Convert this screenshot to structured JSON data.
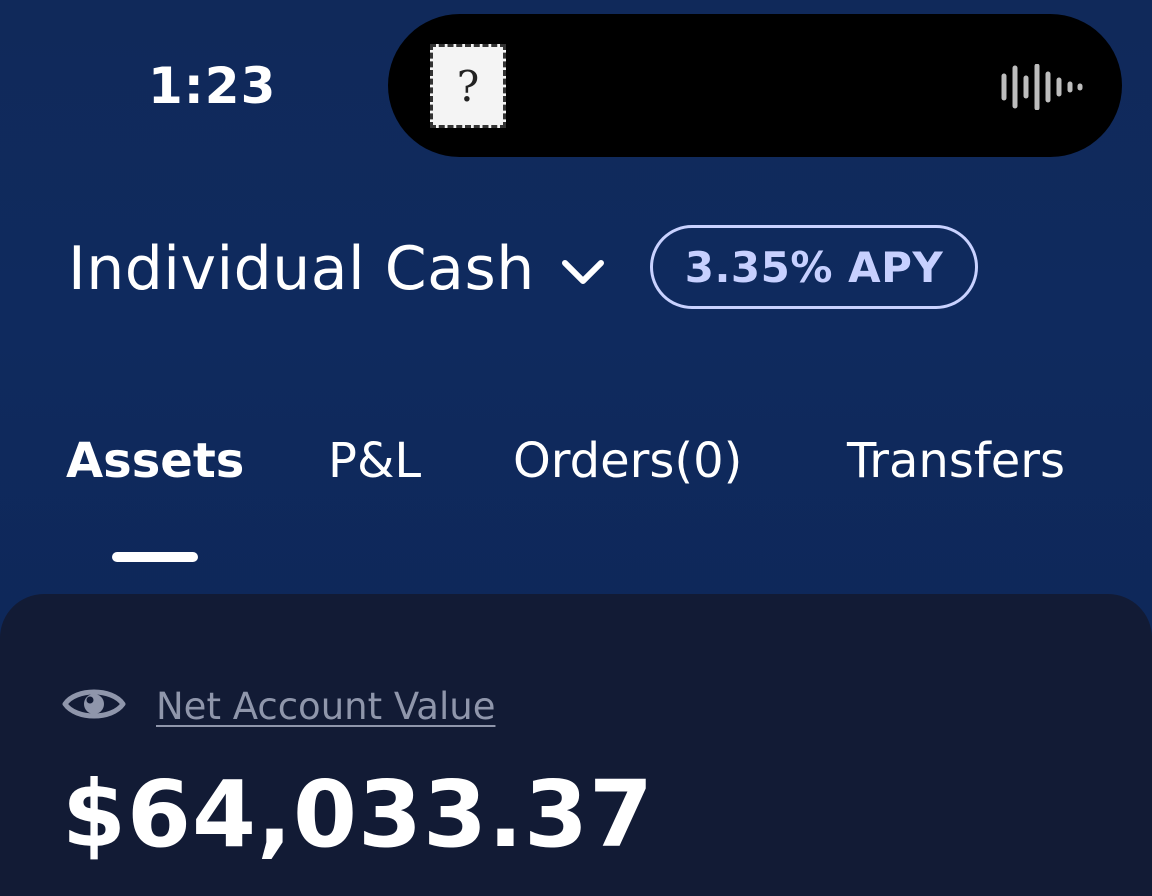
{
  "status_bar": {
    "time": "1:23",
    "island_thumbnail_glyph": "?",
    "island_indicator_icon": "audio-waveform-icon"
  },
  "account": {
    "name": "Individual Cash",
    "selector_icon": "chevron-down-icon",
    "apy_badge": "3.35% APY"
  },
  "tabs": [
    {
      "label": "Assets",
      "active": true
    },
    {
      "label": "P&L",
      "active": false
    },
    {
      "label": "Orders(0)",
      "active": false
    },
    {
      "label": "Transfers",
      "active": false
    }
  ],
  "summary": {
    "visibility_icon": "eye-icon",
    "label": "Net Account Value",
    "value": "$64,033.37"
  },
  "colors": {
    "background": "#0f2a5e",
    "card": "#121b35",
    "badge_accent": "#c7d0ff",
    "muted_text": "#8f96ab"
  }
}
